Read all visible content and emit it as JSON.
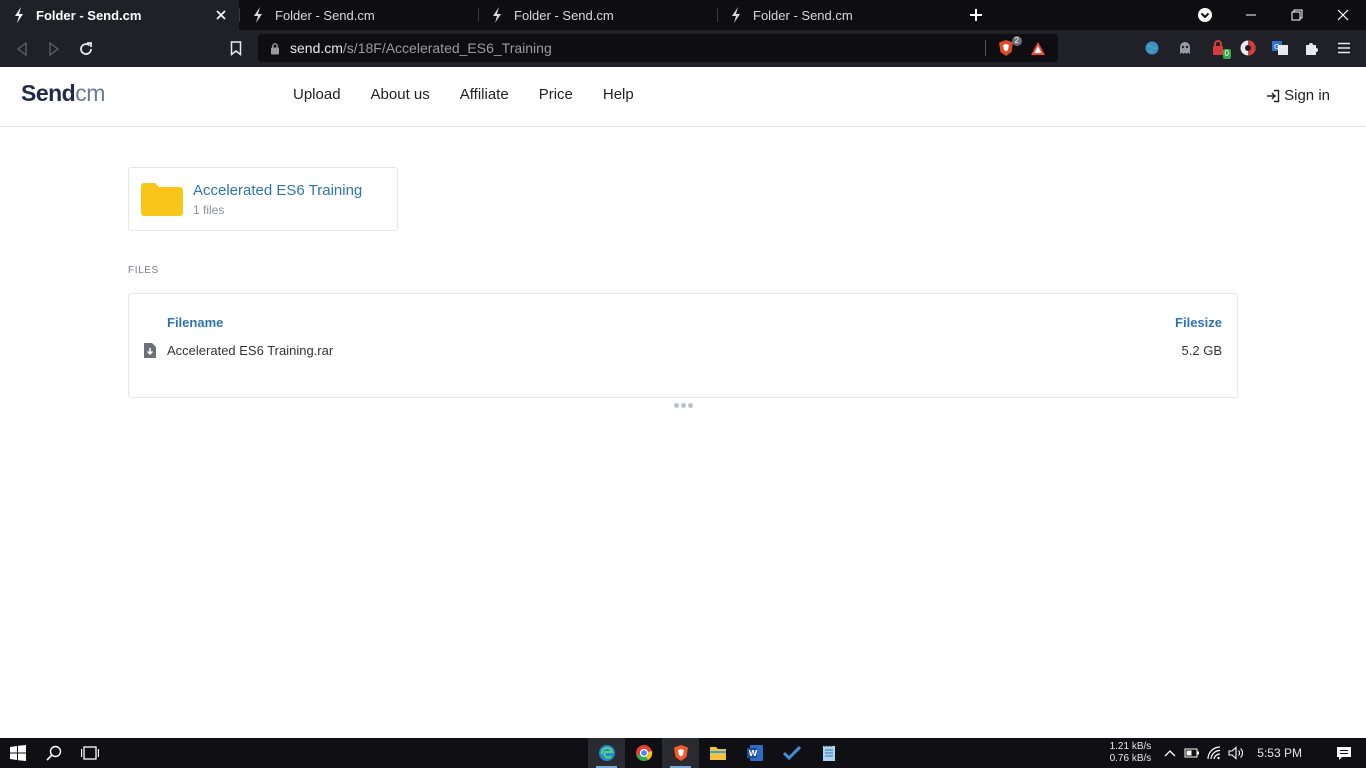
{
  "browser": {
    "tabs": [
      {
        "title": "Folder - Send.cm",
        "active": true
      },
      {
        "title": "Folder - Send.cm",
        "active": false
      },
      {
        "title": "Folder - Send.cm",
        "active": false
      },
      {
        "title": "Folder - Send.cm",
        "active": false
      }
    ],
    "url_host": "send.cm",
    "url_path": "/s/18F/Accelerated_ES6_Training",
    "brave_shield_count": "2",
    "extension_badge": "0"
  },
  "site": {
    "logo_part1": "Send",
    "logo_part2": "cm",
    "nav": [
      "Upload",
      "About us",
      "Affiliate",
      "Price",
      "Help"
    ],
    "signin_label": "Sign in"
  },
  "folder": {
    "name": "Accelerated ES6 Training",
    "count": "1 files"
  },
  "files": {
    "section_label": "FILES",
    "col_filename": "Filename",
    "col_filesize": "Filesize",
    "rows": [
      {
        "name": "Accelerated ES6 Training.rar",
        "size": "5.2 GB"
      }
    ]
  },
  "taskbar": {
    "net_up": "1.21 kB/s",
    "net_down": "0.76 kB/s",
    "time": "5:53 PM"
  },
  "colors": {
    "link": "#2d74b0",
    "folder": "#f9c519",
    "chrome_dark": "#202127"
  }
}
